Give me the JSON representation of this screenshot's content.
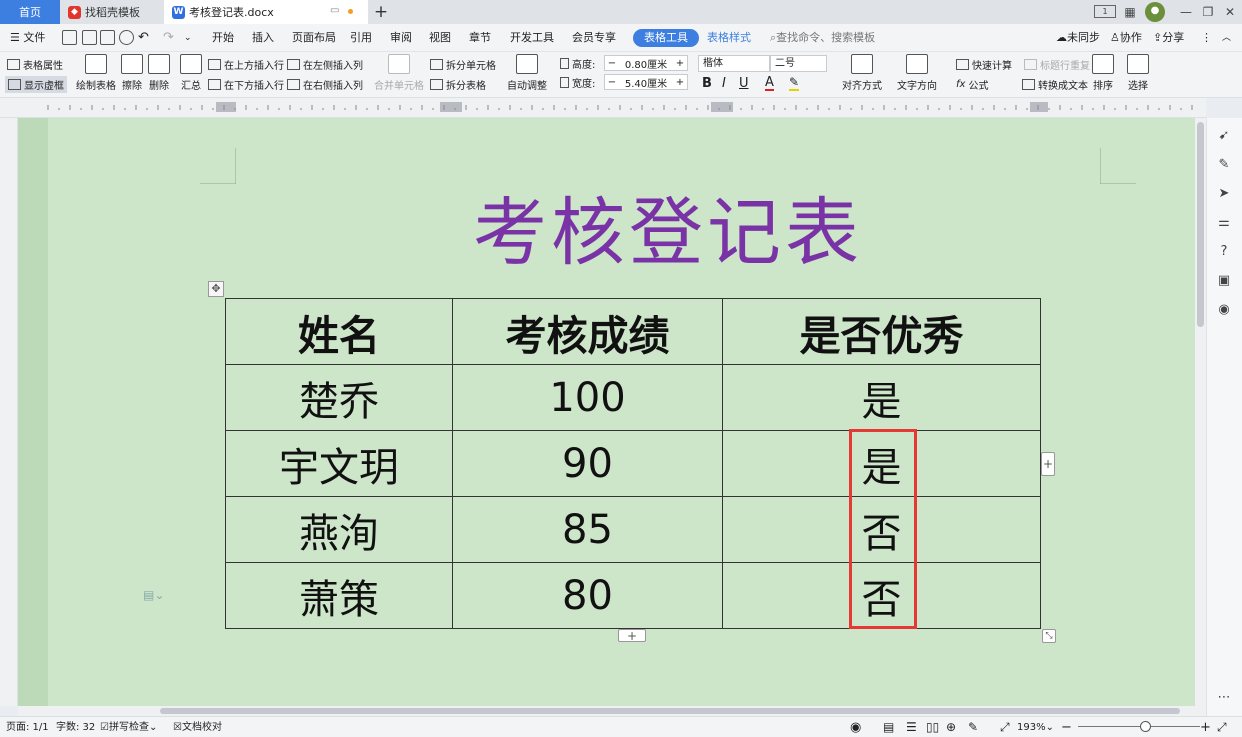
{
  "titlebar": {
    "tabs": [
      {
        "label": "首页"
      },
      {
        "label": "找稻壳模板"
      },
      {
        "label": "考核登记表.docx"
      }
    ]
  },
  "menubar": {
    "file": "文件",
    "items": [
      "开始",
      "插入",
      "页面布局",
      "引用",
      "审阅",
      "视图",
      "章节",
      "开发工具",
      "会员专享",
      "表格工具",
      "表格样式"
    ],
    "search_placeholder": "查找命令、搜索模板",
    "right": [
      "未同步",
      "协作",
      "分享"
    ]
  },
  "ribbon": {
    "table_props": "表格属性",
    "show_gridlines": "显示虚框",
    "draw_table": "绘制表格",
    "erase": "擦除",
    "delete": "删除",
    "summary": "汇总",
    "insert_above": "在上方插入行",
    "insert_below": "在下方插入行",
    "insert_left": "在左侧插入列",
    "insert_right": "在右侧插入列",
    "merge_cells": "合并单元格",
    "split_cells": "拆分单元格",
    "split_table": "拆分表格",
    "auto_fit": "自动调整",
    "height_label": "高度:",
    "height_value": "0.80厘米",
    "width_label": "宽度:",
    "width_value": "5.40厘米",
    "font_name": "楷体",
    "font_size": "二号",
    "quick_calc": "快速计算",
    "repeat_header": "标题行重复",
    "formula": "公式",
    "align": "对齐方式",
    "text_direction": "文字方向",
    "convert_text": "转换成文本",
    "sort": "排序",
    "select": "选择"
  },
  "document": {
    "title": "考核登记表",
    "columns": [
      "姓名",
      "考核成绩",
      "是否优秀"
    ],
    "rows": [
      {
        "name": "楚乔",
        "score": "100",
        "excellent": "是"
      },
      {
        "name": "宇文玥",
        "score": "90",
        "excellent": "是"
      },
      {
        "name": "燕洵",
        "score": "85",
        "excellent": "否"
      },
      {
        "name": "萧策",
        "score": "80",
        "excellent": "否"
      }
    ]
  },
  "statusbar": {
    "page": "页面: 1/1",
    "word_count": "字数: 32",
    "spell_check": "拼写检查",
    "doc_proof": "文档校对",
    "zoom": "193%"
  },
  "colors": {
    "accent": "#3d7fe0",
    "title_purple": "#7a33a6",
    "page_bg": "#cde6c9",
    "highlight_red": "#e53935"
  }
}
